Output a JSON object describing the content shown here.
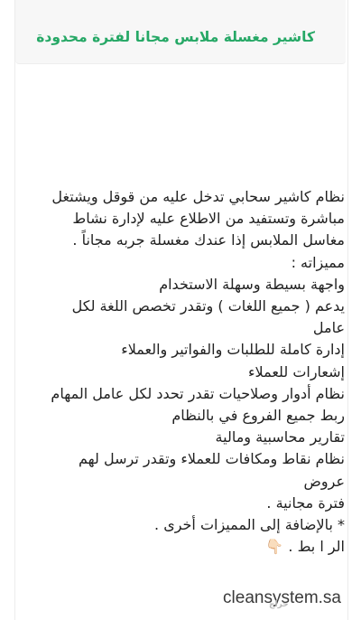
{
  "post": {
    "title": "كاشير مغسلة ملابس مجانا لفترة محدودة",
    "lines": [
      "نظام كاشير سحابي تدخل عليه من قوقل ويشتغل",
      "مباشرة وتستفيد من الاطلاع عليه لإدارة نشاط",
      "مغاسل الملابس إذا عندك مغسلة جربه مجاناً .",
      "مميزاته :",
      "واجهة بسيطة وسهلة الاستخدام",
      "يدعم ( جميع اللغات ) وتقدر تخصص اللغة لكل",
      "عامل",
      "إدارة كاملة للطلبات والفواتير والعملاء",
      "إشعارات للعملاء",
      "نظام أدوار وصلاحيات تقدر تحدد لكل عامل المهام",
      "ربط جميع الفروع في بالنظام",
      "تقارير محاسبية ومالية",
      "نظام نقاط ومكافات للعملاء وتقدر ترسل لهم",
      "عروض",
      "فترة مجانية .",
      "* بالإضافة إلى المميزات أخرى .",
      "الر ا بط . 👇🏻"
    ],
    "link": "cleansystem.sa",
    "watermark": "حراج"
  }
}
